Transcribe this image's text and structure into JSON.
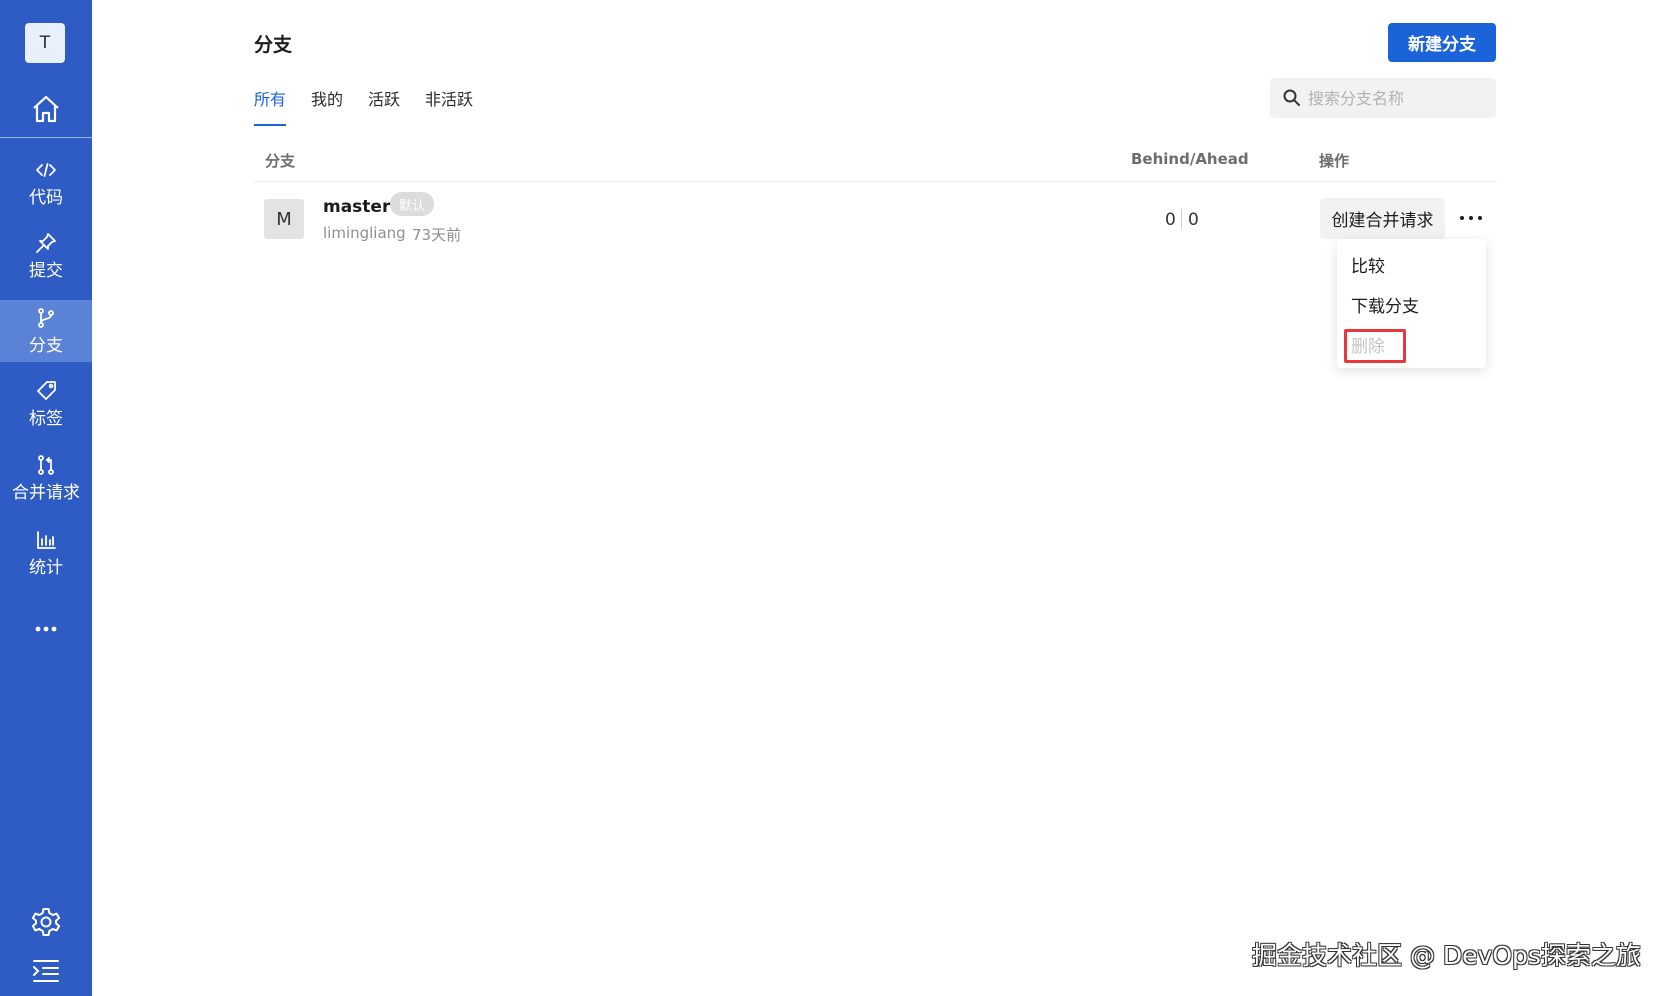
{
  "sidebar": {
    "project_initial": "T",
    "items": [
      {
        "label": "代码",
        "icon": "code-icon"
      },
      {
        "label": "提交",
        "icon": "pin-icon"
      },
      {
        "label": "分支",
        "icon": "branch-icon",
        "active": true
      },
      {
        "label": "标签",
        "icon": "tag-icon"
      },
      {
        "label": "合并请求",
        "icon": "merge-request-icon"
      },
      {
        "label": "统计",
        "icon": "chart-icon"
      }
    ]
  },
  "header": {
    "title": "分支",
    "new_branch_label": "新建分支"
  },
  "tabs": [
    {
      "label": "所有",
      "active": true
    },
    {
      "label": "我的"
    },
    {
      "label": "活跃"
    },
    {
      "label": "非活跃"
    }
  ],
  "search": {
    "placeholder": "搜索分支名称"
  },
  "table": {
    "columns": [
      "分支",
      "Behind/Ahead",
      "操作"
    ],
    "rows": [
      {
        "avatar": "M",
        "name": "master",
        "badge": "默认",
        "author": "limingliang",
        "time": "73天前",
        "behind": "0",
        "ahead": "0",
        "action_label": "创建合并请求"
      }
    ]
  },
  "dropdown": {
    "items": [
      {
        "label": "比较"
      },
      {
        "label": "下载分支"
      },
      {
        "label": "删除",
        "disabled": true
      }
    ]
  },
  "watermark": "掘金技术社区 @ DevOps探索之旅",
  "colors": {
    "sidebar": "#2f5cc4",
    "primary": "#1b63d9",
    "highlight": "#e8383d"
  }
}
